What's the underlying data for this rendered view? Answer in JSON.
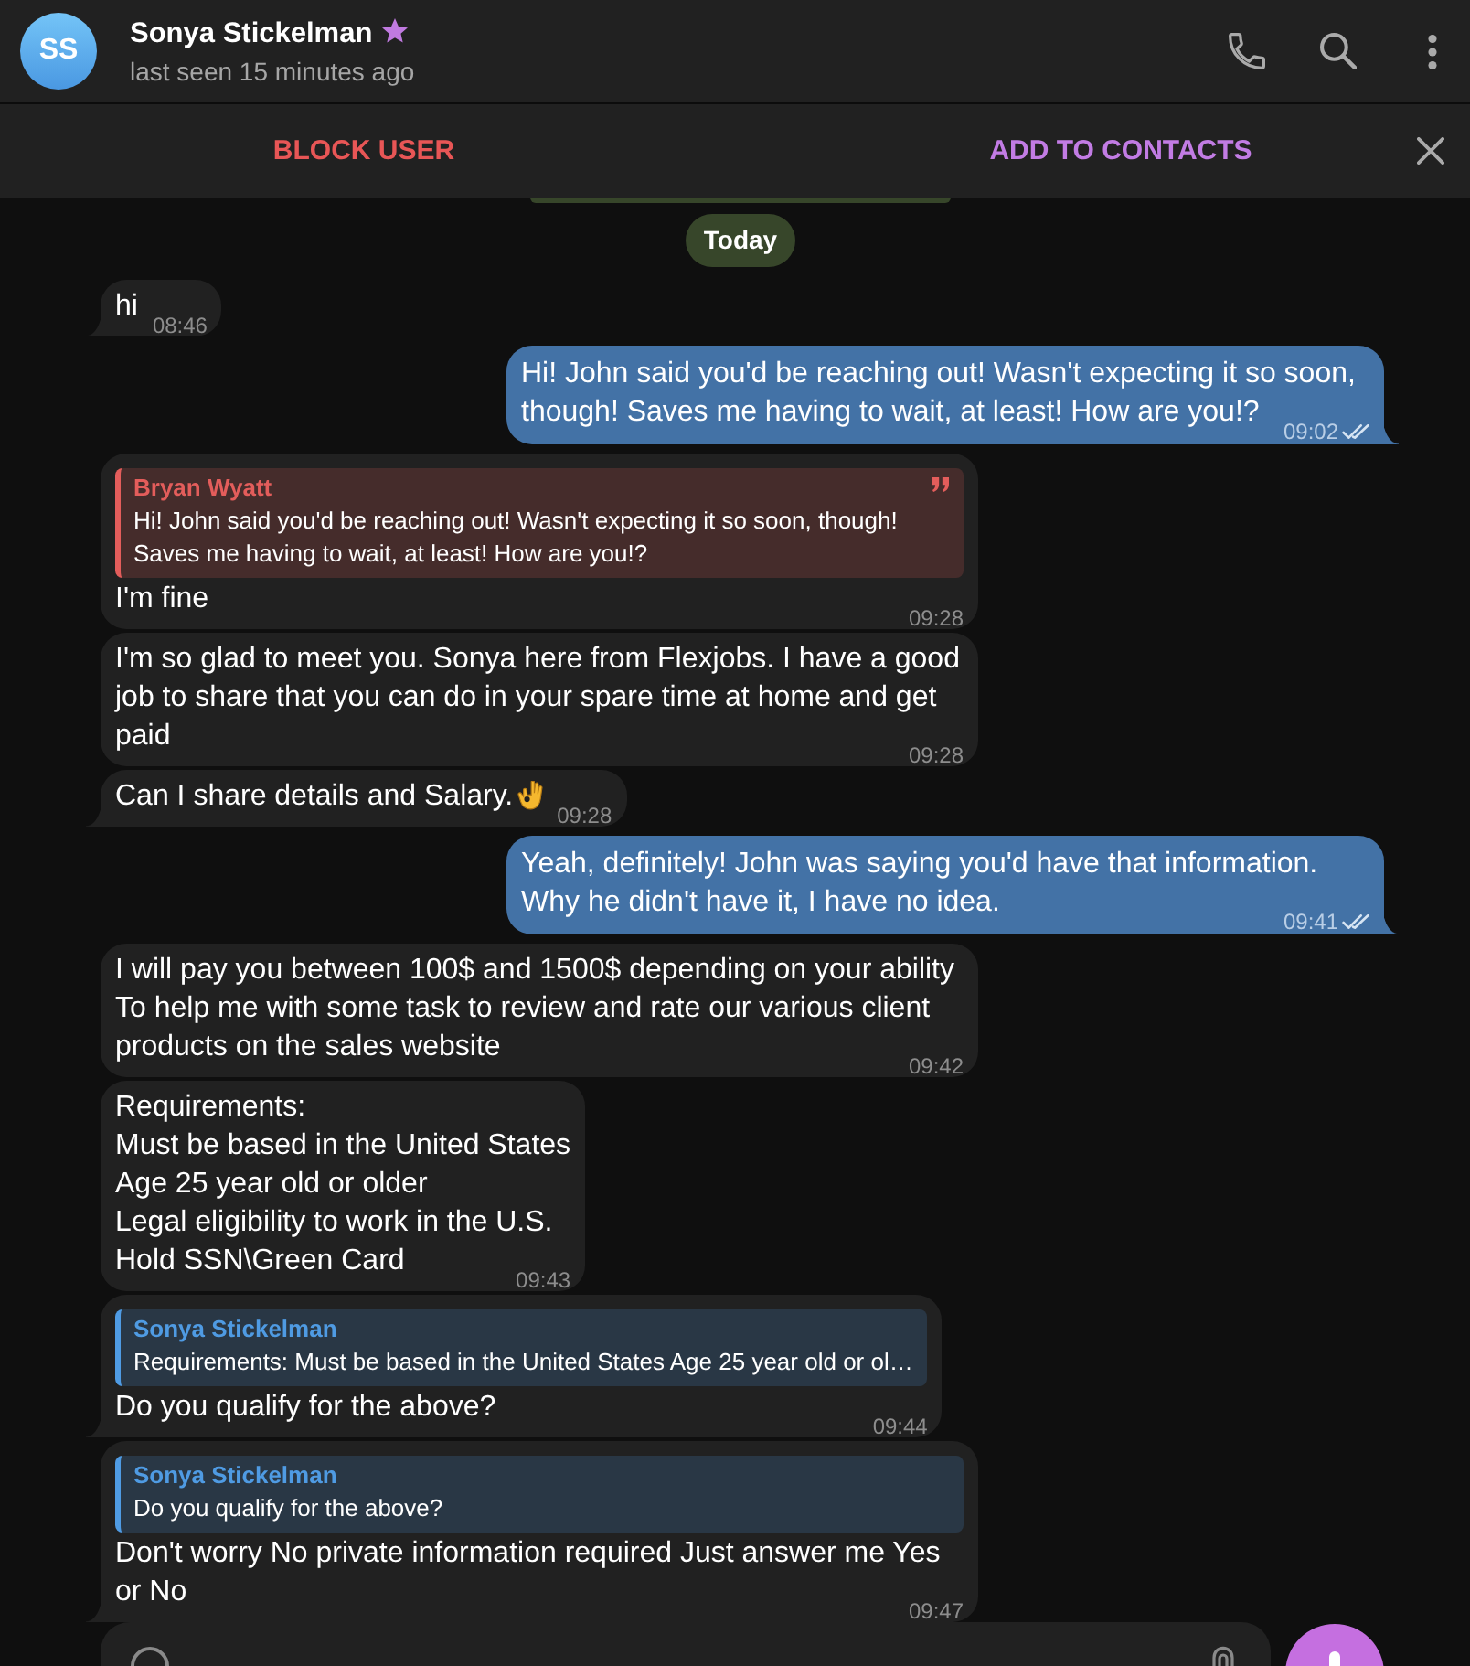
{
  "header": {
    "avatar_initials": "SS",
    "name": "Sonya Stickelman",
    "premium": true,
    "status": "last seen 15 minutes ago"
  },
  "action_bar": {
    "buttons": [
      {
        "label": "BLOCK USER",
        "kind": "danger"
      },
      {
        "label": "ADD TO CONTACTS",
        "kind": "primary"
      }
    ]
  },
  "date_pill": "Today",
  "messages": [
    {
      "kind": "incoming",
      "text": "hi",
      "time": "08:46",
      "tail": true
    },
    {
      "kind": "outgoing",
      "text": "Hi! John said you'd be reaching out! Wasn't expecting it so soon, though! Saves me having to wait, at least! How are you!?",
      "time": "09:02",
      "read": true,
      "tail": true
    },
    {
      "kind": "incoming",
      "reply": {
        "author": "Bryan Wyatt",
        "text": "Hi! John said you'd be reaching out! Wasn't expecting it so soon, though! Saves me having to wait, at least! How are you!?",
        "color": "#e35d5b",
        "quote_icon": true
      },
      "text": "I'm fine",
      "time": "09:28",
      "tail": false
    },
    {
      "kind": "incoming",
      "text": "I'm so glad to meet you. Sonya here from Flexjobs. I have a good job to share that you can do in your spare time at home and get paid",
      "time": "09:28",
      "tail": false
    },
    {
      "kind": "incoming",
      "text": "Can I share details and Salary.",
      "emoji_icon": true,
      "time": "09:28",
      "tail": true
    },
    {
      "kind": "outgoing",
      "text": "Yeah, definitely! John was saying you'd have that information. Why he didn't have it, I have no idea.",
      "time": "09:41",
      "read": true,
      "tail": true
    },
    {
      "kind": "incoming",
      "text": "I will pay you between 100$ and 1500$ depending on your ability\nTo help me with some task to review and rate our various client products on the sales website",
      "time": "09:42",
      "tail": false
    },
    {
      "kind": "incoming",
      "text": "Requirements:\nMust be based in the United States\nAge 25 year old or older\nLegal eligibility to work in the U.S.\nHold SSN\\Green Card",
      "time": "09:43",
      "tail": false
    },
    {
      "kind": "incoming",
      "reply": {
        "author": "Sonya Stickelman",
        "text": "Requirements: Must be based in the United States Age 25 year old or ol…",
        "color": "#4f9be3",
        "quote_icon": false
      },
      "text": "Do you qualify for the above?",
      "time": "09:44",
      "tail": true
    },
    {
      "kind": "incoming",
      "reply": {
        "author": "Sonya Stickelman",
        "text": "Do you qualify for the above?",
        "color": "#4f9be3",
        "quote_icon": false
      },
      "text": "Don't worry No private information required Just answer me Yes or No",
      "time": "09:47",
      "tail": true
    }
  ]
}
